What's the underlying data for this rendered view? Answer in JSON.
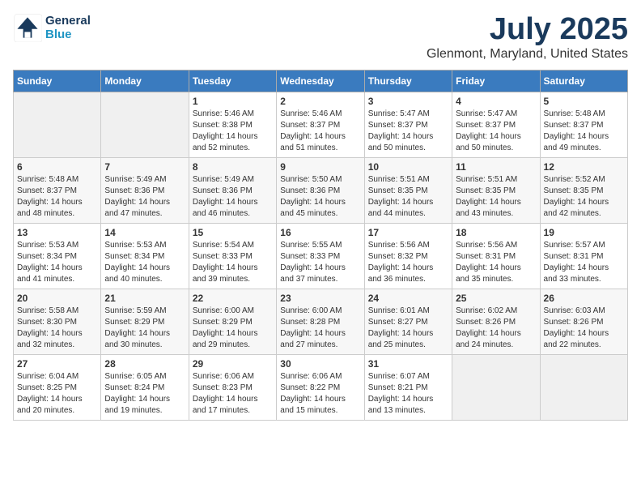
{
  "logo": {
    "line1": "General",
    "line2": "Blue"
  },
  "title": "July 2025",
  "subtitle": "Glenmont, Maryland, United States",
  "weekdays": [
    "Sunday",
    "Monday",
    "Tuesday",
    "Wednesday",
    "Thursday",
    "Friday",
    "Saturday"
  ],
  "weeks": [
    [
      {
        "day": "",
        "sunrise": "",
        "sunset": "",
        "daylight": ""
      },
      {
        "day": "",
        "sunrise": "",
        "sunset": "",
        "daylight": ""
      },
      {
        "day": "1",
        "sunrise": "5:46 AM",
        "sunset": "8:38 PM",
        "daylight": "14 hours and 52 minutes."
      },
      {
        "day": "2",
        "sunrise": "5:46 AM",
        "sunset": "8:37 PM",
        "daylight": "14 hours and 51 minutes."
      },
      {
        "day": "3",
        "sunrise": "5:47 AM",
        "sunset": "8:37 PM",
        "daylight": "14 hours and 50 minutes."
      },
      {
        "day": "4",
        "sunrise": "5:47 AM",
        "sunset": "8:37 PM",
        "daylight": "14 hours and 50 minutes."
      },
      {
        "day": "5",
        "sunrise": "5:48 AM",
        "sunset": "8:37 PM",
        "daylight": "14 hours and 49 minutes."
      }
    ],
    [
      {
        "day": "6",
        "sunrise": "5:48 AM",
        "sunset": "8:37 PM",
        "daylight": "14 hours and 48 minutes."
      },
      {
        "day": "7",
        "sunrise": "5:49 AM",
        "sunset": "8:36 PM",
        "daylight": "14 hours and 47 minutes."
      },
      {
        "day": "8",
        "sunrise": "5:49 AM",
        "sunset": "8:36 PM",
        "daylight": "14 hours and 46 minutes."
      },
      {
        "day": "9",
        "sunrise": "5:50 AM",
        "sunset": "8:36 PM",
        "daylight": "14 hours and 45 minutes."
      },
      {
        "day": "10",
        "sunrise": "5:51 AM",
        "sunset": "8:35 PM",
        "daylight": "14 hours and 44 minutes."
      },
      {
        "day": "11",
        "sunrise": "5:51 AM",
        "sunset": "8:35 PM",
        "daylight": "14 hours and 43 minutes."
      },
      {
        "day": "12",
        "sunrise": "5:52 AM",
        "sunset": "8:35 PM",
        "daylight": "14 hours and 42 minutes."
      }
    ],
    [
      {
        "day": "13",
        "sunrise": "5:53 AM",
        "sunset": "8:34 PM",
        "daylight": "14 hours and 41 minutes."
      },
      {
        "day": "14",
        "sunrise": "5:53 AM",
        "sunset": "8:34 PM",
        "daylight": "14 hours and 40 minutes."
      },
      {
        "day": "15",
        "sunrise": "5:54 AM",
        "sunset": "8:33 PM",
        "daylight": "14 hours and 39 minutes."
      },
      {
        "day": "16",
        "sunrise": "5:55 AM",
        "sunset": "8:33 PM",
        "daylight": "14 hours and 37 minutes."
      },
      {
        "day": "17",
        "sunrise": "5:56 AM",
        "sunset": "8:32 PM",
        "daylight": "14 hours and 36 minutes."
      },
      {
        "day": "18",
        "sunrise": "5:56 AM",
        "sunset": "8:31 PM",
        "daylight": "14 hours and 35 minutes."
      },
      {
        "day": "19",
        "sunrise": "5:57 AM",
        "sunset": "8:31 PM",
        "daylight": "14 hours and 33 minutes."
      }
    ],
    [
      {
        "day": "20",
        "sunrise": "5:58 AM",
        "sunset": "8:30 PM",
        "daylight": "14 hours and 32 minutes."
      },
      {
        "day": "21",
        "sunrise": "5:59 AM",
        "sunset": "8:29 PM",
        "daylight": "14 hours and 30 minutes."
      },
      {
        "day": "22",
        "sunrise": "6:00 AM",
        "sunset": "8:29 PM",
        "daylight": "14 hours and 29 minutes."
      },
      {
        "day": "23",
        "sunrise": "6:00 AM",
        "sunset": "8:28 PM",
        "daylight": "14 hours and 27 minutes."
      },
      {
        "day": "24",
        "sunrise": "6:01 AM",
        "sunset": "8:27 PM",
        "daylight": "14 hours and 25 minutes."
      },
      {
        "day": "25",
        "sunrise": "6:02 AM",
        "sunset": "8:26 PM",
        "daylight": "14 hours and 24 minutes."
      },
      {
        "day": "26",
        "sunrise": "6:03 AM",
        "sunset": "8:26 PM",
        "daylight": "14 hours and 22 minutes."
      }
    ],
    [
      {
        "day": "27",
        "sunrise": "6:04 AM",
        "sunset": "8:25 PM",
        "daylight": "14 hours and 20 minutes."
      },
      {
        "day": "28",
        "sunrise": "6:05 AM",
        "sunset": "8:24 PM",
        "daylight": "14 hours and 19 minutes."
      },
      {
        "day": "29",
        "sunrise": "6:06 AM",
        "sunset": "8:23 PM",
        "daylight": "14 hours and 17 minutes."
      },
      {
        "day": "30",
        "sunrise": "6:06 AM",
        "sunset": "8:22 PM",
        "daylight": "14 hours and 15 minutes."
      },
      {
        "day": "31",
        "sunrise": "6:07 AM",
        "sunset": "8:21 PM",
        "daylight": "14 hours and 13 minutes."
      },
      {
        "day": "",
        "sunrise": "",
        "sunset": "",
        "daylight": ""
      },
      {
        "day": "",
        "sunrise": "",
        "sunset": "",
        "daylight": ""
      }
    ]
  ],
  "labels": {
    "sunrise": "Sunrise:",
    "sunset": "Sunset:",
    "daylight": "Daylight:"
  }
}
